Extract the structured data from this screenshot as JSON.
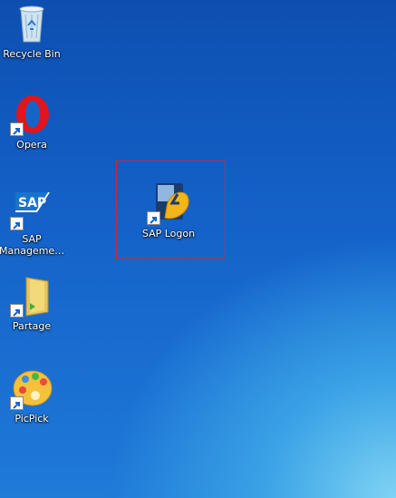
{
  "desktop": {
    "icons": [
      {
        "label": "Recycle Bin"
      },
      {
        "label": "Opera"
      },
      {
        "label": "SAP\nManageme…"
      },
      {
        "label": "Partage"
      },
      {
        "label": "PicPick"
      },
      {
        "label": "SAP Logon"
      }
    ],
    "highlight_color": "#d8262b"
  }
}
